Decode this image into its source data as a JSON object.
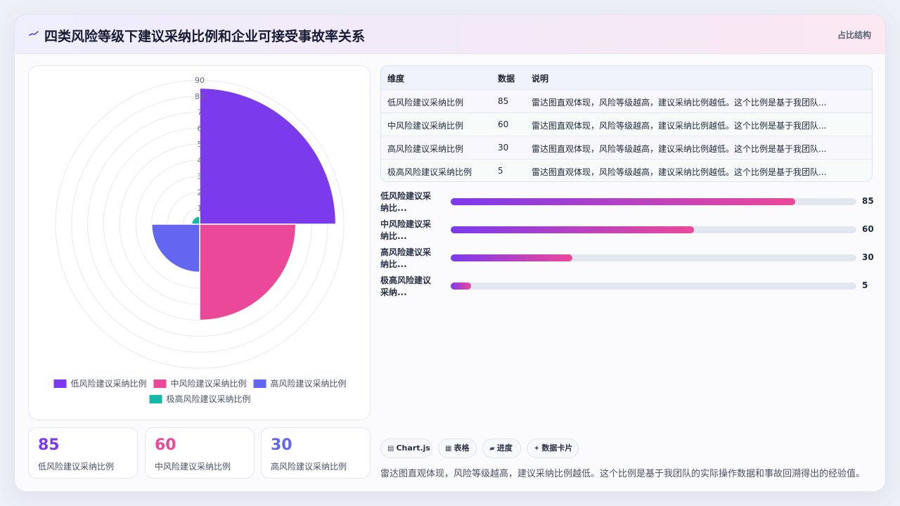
{
  "header": {
    "title": "四类风险等级下建议采纳比例和企业可接受事故率关系",
    "tag": "占比结构"
  },
  "colors": {
    "low": "#7c3aed",
    "mid": "#ec4899",
    "high": "#6366f1",
    "extreme": "#14b8a6"
  },
  "chart_data": {
    "type": "polarArea",
    "categories": [
      "低风险建议采纳比例",
      "中风险建议采纳比例",
      "高风险建议采纳比例",
      "极高风险建议采纳比例"
    ],
    "values": [
      85,
      60,
      30,
      5
    ],
    "r_ticks": [
      10,
      20,
      30,
      40,
      50,
      60,
      70,
      80,
      90
    ],
    "r_range": [
      0,
      90
    ],
    "tick_labels": [
      "1",
      "2",
      "3",
      "4",
      "5",
      "6",
      "7",
      "80",
      "90"
    ],
    "legend_position": "bottom",
    "grid": true
  },
  "stats": [
    {
      "value": "85",
      "label": "低风险建议采纳比例"
    },
    {
      "value": "60",
      "label": "中风险建议采纳比例"
    },
    {
      "value": "30",
      "label": "高风险建议采纳比例"
    }
  ],
  "table": {
    "headers": [
      "维度",
      "数据",
      "说明"
    ],
    "rows": [
      {
        "name": "低风险建议采纳比例",
        "value": "85",
        "desc": "雷达图直观体现，风险等级越高，建议采纳比例越低。这个比例是基于我团队..."
      },
      {
        "name": "中风险建议采纳比例",
        "value": "60",
        "desc": "雷达图直观体现，风险等级越高，建议采纳比例越低。这个比例是基于我团队..."
      },
      {
        "name": "高风险建议采纳比例",
        "value": "30",
        "desc": "雷达图直观体现，风险等级越高，建议采纳比例越低。这个比例是基于我团队..."
      },
      {
        "name": "极高风险建议采纳比例",
        "value": "5",
        "desc": "雷达图直观体现，风险等级越高，建议采纳比例越低。这个比例是基于我团队..."
      }
    ]
  },
  "bars": {
    "max": 100,
    "items": [
      {
        "label": "低风险建议采纳比...",
        "value": 85
      },
      {
        "label": "中风险建议采纳比...",
        "value": 60
      },
      {
        "label": "高风险建议采纳比...",
        "value": 30
      },
      {
        "label": "极高风险建议采纳...",
        "value": 5
      }
    ]
  },
  "chips": [
    {
      "icon": "chart-icon",
      "glyph": "▤",
      "label": "Chart.js"
    },
    {
      "icon": "table-icon",
      "glyph": "▦",
      "label": "表格"
    },
    {
      "icon": "progress-icon",
      "glyph": "▰",
      "label": "进度"
    },
    {
      "icon": "sparkle-icon",
      "glyph": "✦",
      "label": "数据卡片"
    }
  ],
  "footnote": "雷达图直观体现，风险等级越高，建议采纳比例越低。这个比例是基于我团队的实际操作数据和事故回溯得出的经验值。"
}
